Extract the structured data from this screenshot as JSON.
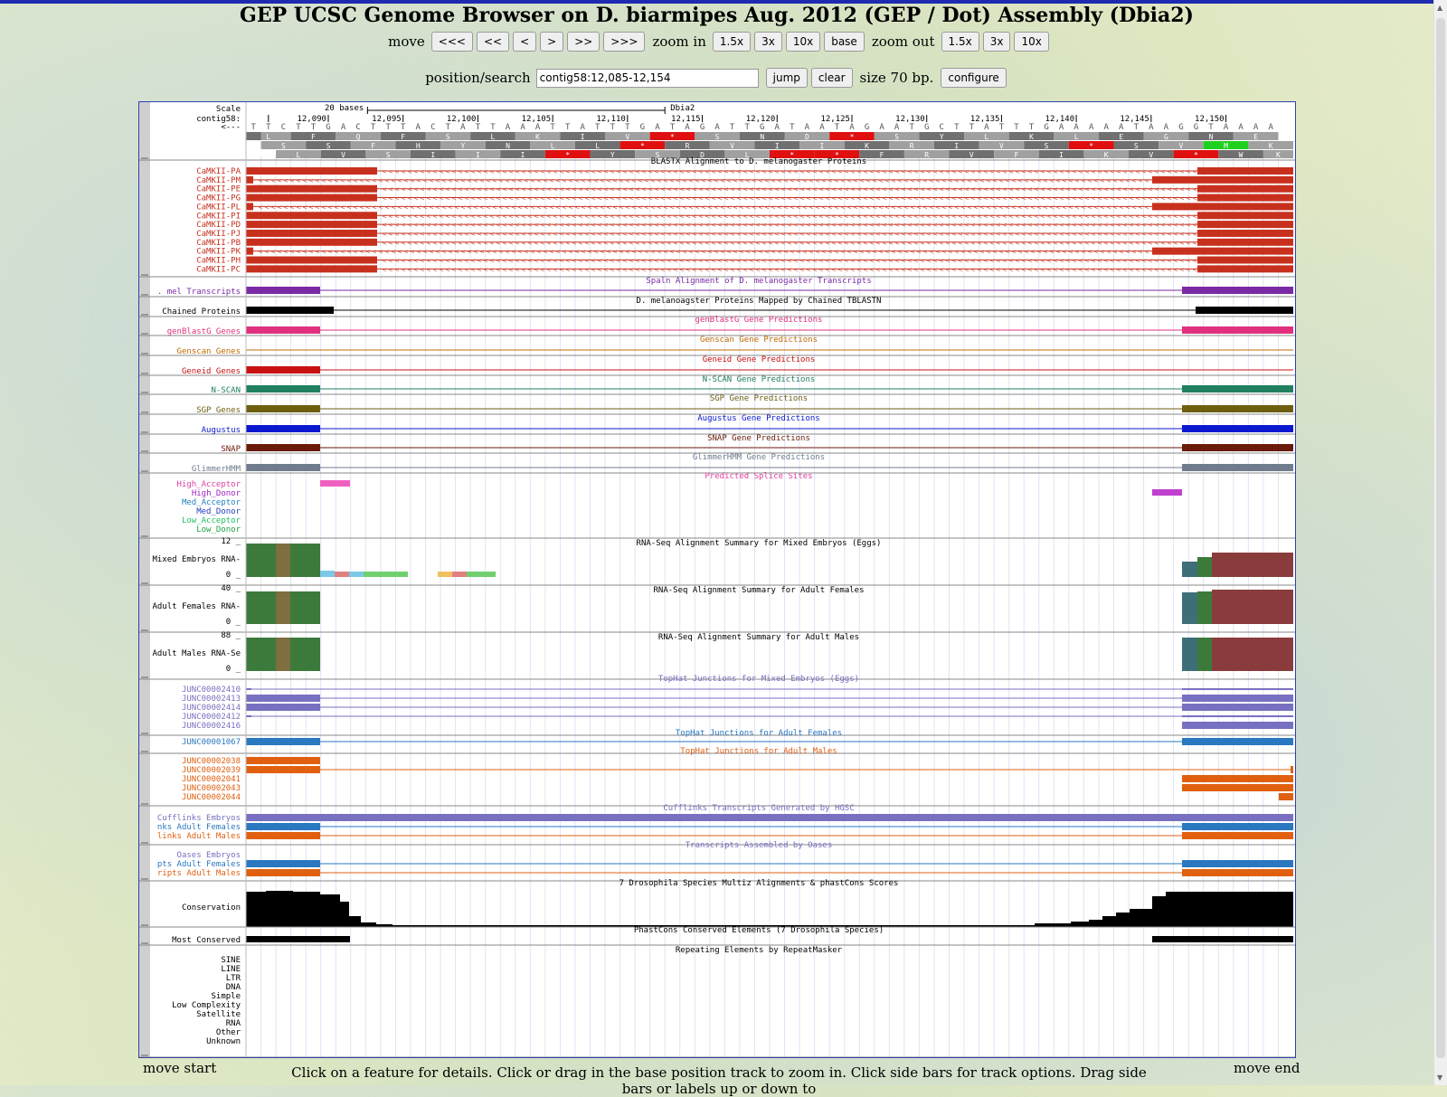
{
  "page_title": "GEP UCSC Genome Browser on D. biarmipes Aug. 2012 (GEP / Dot) Assembly (Dbia2)",
  "nav": {
    "move_label": "move",
    "move_buttons": [
      "<<<",
      "<<",
      "<",
      ">",
      ">>",
      ">>>"
    ],
    "zoom_in_label": "zoom in",
    "zoom_in_buttons": [
      "1.5x",
      "3x",
      "10x",
      "base"
    ],
    "zoom_out_label": "zoom out",
    "zoom_out_buttons": [
      "1.5x",
      "3x",
      "10x"
    ]
  },
  "position": {
    "label": "position/search",
    "value": "contig58:12,085-12,154",
    "jump": "jump",
    "clear": "clear",
    "size_text": "size 70 bp.",
    "configure": "configure"
  },
  "bottom": {
    "move_start": "move start",
    "move_end": "move end",
    "help_text": "Click on a feature for details. Click or drag in the base position track to zoom in. Click side bars for track options. Drag side bars or labels up or down to"
  },
  "browser": {
    "region": {
      "chrom": "contig58",
      "start": 12085,
      "end": 12154
    },
    "scale": {
      "label": "Scale",
      "chrom_label": "contig58:",
      "strand_label": "<---",
      "bar_text": "20 bases",
      "assembly": "Dbia2"
    },
    "ticks": [
      "12,090",
      "12,095",
      "12,100",
      "12,105",
      "12,110",
      "12,115",
      "12,120",
      "12,125",
      "12,130",
      "12,135",
      "12,140",
      "12,145",
      "12,150"
    ],
    "sequence": "TTCTTGACTTTACTATTAAATTATTTGATAGATTGATAATAGAATGCTTATTTGAAAAATAAGGTAAAA",
    "aa_frames": [
      [
        "L",
        "F",
        "Q",
        "F",
        "S",
        "L",
        "K",
        "I",
        "V",
        "*",
        "S",
        "N",
        "D",
        "*",
        "S",
        "Y",
        "L",
        "K",
        "L",
        "E",
        "G",
        "N",
        "E"
      ],
      [
        "S",
        "S",
        "F",
        "H",
        "Y",
        "N",
        "L",
        "L",
        "*",
        "R",
        "V",
        "I",
        "I",
        "K",
        "R",
        "I",
        "V",
        "S",
        "*",
        "S",
        "V",
        "M",
        "K"
      ],
      [
        "L",
        "V",
        "S",
        "I",
        "I",
        "I",
        "*",
        "Y",
        "S",
        "D",
        "L",
        "*",
        "*",
        "F",
        "R",
        "V",
        "F",
        "I",
        "K",
        "V",
        "*",
        "W",
        "K"
      ]
    ],
    "colors": {
      "blastx": "#c8301e",
      "transcripts": "#7b2aa6",
      "chained": "#000000",
      "genblastg": "#e0307e",
      "genscan": "#c06a00",
      "geneid": "#c81010",
      "nscan": "#208060",
      "sgp": "#6e5e10",
      "augustus": "#0a18d0",
      "snap": "#6a1a08",
      "glimmer": "#707c8e",
      "tophat_embryo": "#7870c0",
      "tophat_female": "#2a78c0",
      "tophat_male": "#e06010",
      "cufflinks_embryo": "#7870c0",
      "cufflinks_female": "#2a78c0",
      "cufflinks_male": "#e06010",
      "rnaseq_green": "#3c7a3c",
      "rnaseq_brown": "#7e6e40",
      "rnaseq_maroon": "#8a3c3c",
      "rnaseq_teal": "#3e6e78"
    },
    "tracks": {
      "blastx": {
        "title": "BLASTX Alignment to D. melanogaster Proteins",
        "items": [
          "CaMKII-PA",
          "CaMKII-PM",
          "CaMKII-PE",
          "CaMKII-PG",
          "CaMKII-PL",
          "CaMKII-PI",
          "CaMKII-PD",
          "CaMKII-PJ",
          "CaMKII-PB",
          "CaMKII-PK",
          "CaMKII-PH",
          "CaMKII-PC"
        ]
      },
      "transcripts": {
        "title": "Spaln Alignment of D. melanogaster Transcripts",
        "label": ". mel Transcripts"
      },
      "chained": {
        "title": "D. melanoagster Proteins Mapped by Chained TBLASTN",
        "label": "Chained Proteins"
      },
      "genblastg": {
        "title": "genBlastG Gene Predictions",
        "label": "genBlastG Genes"
      },
      "genscan": {
        "title": "Genscan Gene Predictions",
        "label": "Genscan Genes"
      },
      "geneid": {
        "title": "Geneid Gene Predictions",
        "label": "Geneid Genes"
      },
      "nscan": {
        "title": "N-SCAN Gene Predictions",
        "label": "N-SCAN"
      },
      "sgp": {
        "title": "SGP Gene Predictions",
        "label": "SGP Genes"
      },
      "augustus": {
        "title": "Augustus Gene Predictions",
        "label": "Augustus"
      },
      "snap": {
        "title": "SNAP Gene Predictions",
        "label": "SNAP"
      },
      "glimmer": {
        "title": "GlimmerHMM Gene Predictions",
        "label": "GlimmerHMM"
      },
      "splice": {
        "title": "Predicted Splice Sites",
        "labels": [
          {
            "text": "High_Acceptor",
            "color": "#e040a0"
          },
          {
            "text": "High_Donor",
            "color": "#a020c0"
          },
          {
            "text": "Med_Acceptor",
            "color": "#2080c0"
          },
          {
            "text": "Med_Donor",
            "color": "#2040c0"
          },
          {
            "text": "Low_Acceptor",
            "color": "#20c060"
          },
          {
            "text": "Low_Donor",
            "color": "#20a040"
          }
        ]
      },
      "rnaseq_embryo": {
        "title": "RNA-Seq Alignment Summary for Mixed Embryos (Eggs)",
        "label": "Mixed Embryos RNA-",
        "max": "12",
        "min": "0"
      },
      "rnaseq_female": {
        "title": "RNA-Seq Alignment Summary for Adult Females",
        "label": "Adult Females RNA-",
        "max": "40",
        "min": "0"
      },
      "rnaseq_male": {
        "title": "RNA-Seq Alignment Summary for Adult Males",
        "label": "Adult Males RNA-Se",
        "max": "88",
        "min": "0"
      },
      "tophat_embryo": {
        "title": "TopHat Junctions for Mixed Embryos (Eggs)",
        "items": [
          "JUNC00002410",
          "JUNC00002413",
          "JUNC00002414",
          "JUNC00002412",
          "JUNC00002416"
        ]
      },
      "tophat_female": {
        "title": "TopHat Junctions for Adult Females",
        "items": [
          "JUNC00001067"
        ]
      },
      "tophat_male": {
        "title": "TopHat Junctions for Adult Males",
        "items": [
          "JUNC00002038",
          "JUNC00002039",
          "JUNC00002041",
          "JUNC00002043",
          "JUNC00002044"
        ]
      },
      "cufflinks": {
        "title": "Cufflinks Transcripts Generated by HGSC",
        "labels": [
          "Cufflinks Embryos",
          "nks Adult Females",
          "links Adult Males"
        ]
      },
      "oases": {
        "title": "Transcripts Assembled by Oases",
        "labels": [
          "Oases Embryos",
          "pts Adult Females",
          "ripts Adult Males"
        ]
      },
      "conservation": {
        "title": "7 Drosophila Species Multiz Alignments & phastCons Scores",
        "label": "Conservation"
      },
      "most_conserved": {
        "title": "PhastCons Conserved Elements (7 Drosophila Species)",
        "label": "Most Conserved"
      },
      "repeatmasker": {
        "title": "Repeating Elements by RepeatMasker",
        "labels": [
          "SINE",
          "LINE",
          "LTR",
          "DNA",
          "Simple",
          "Low Complexity",
          "Satellite",
          "RNA",
          "Other",
          "Unknown"
        ]
      }
    }
  }
}
